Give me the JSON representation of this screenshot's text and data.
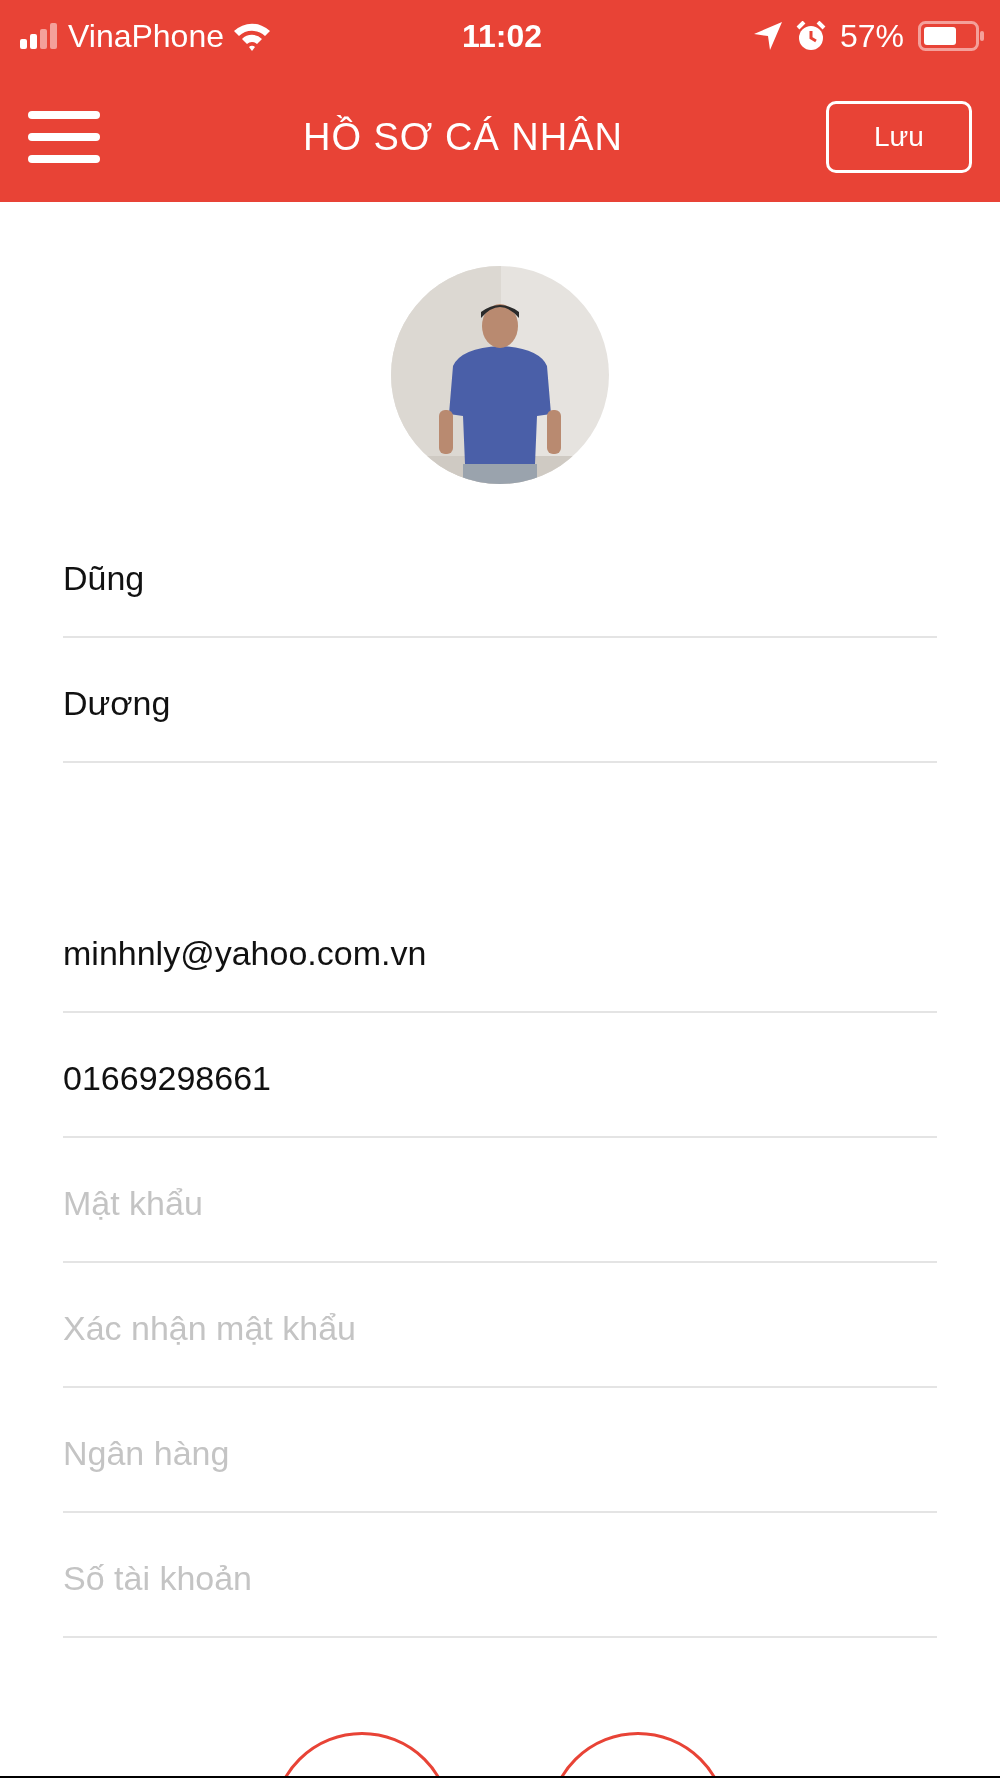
{
  "status_bar": {
    "carrier": "VinaPhone",
    "time": "11:02",
    "battery": "57%"
  },
  "header": {
    "title": "HỒ SƠ CÁ NHÂN",
    "save_button": "Lưu"
  },
  "fields": [
    {
      "kind": "field",
      "value": "Dũng"
    },
    {
      "kind": "field",
      "value": "Dương"
    },
    {
      "kind": "spacer"
    },
    {
      "kind": "field",
      "value": "minhnly@yahoo.com.vn"
    },
    {
      "kind": "field",
      "value": "01669298661"
    },
    {
      "kind": "field",
      "placeholder": "Mật khẩu"
    },
    {
      "kind": "field",
      "placeholder": "Xác nhận mật khẩu"
    },
    {
      "kind": "field",
      "placeholder": "Ngân hàng"
    },
    {
      "kind": "field",
      "placeholder": "Số tài khoản"
    }
  ],
  "bottom_buttons": [
    {
      "kind": "round"
    },
    {
      "kind": "round"
    }
  ]
}
